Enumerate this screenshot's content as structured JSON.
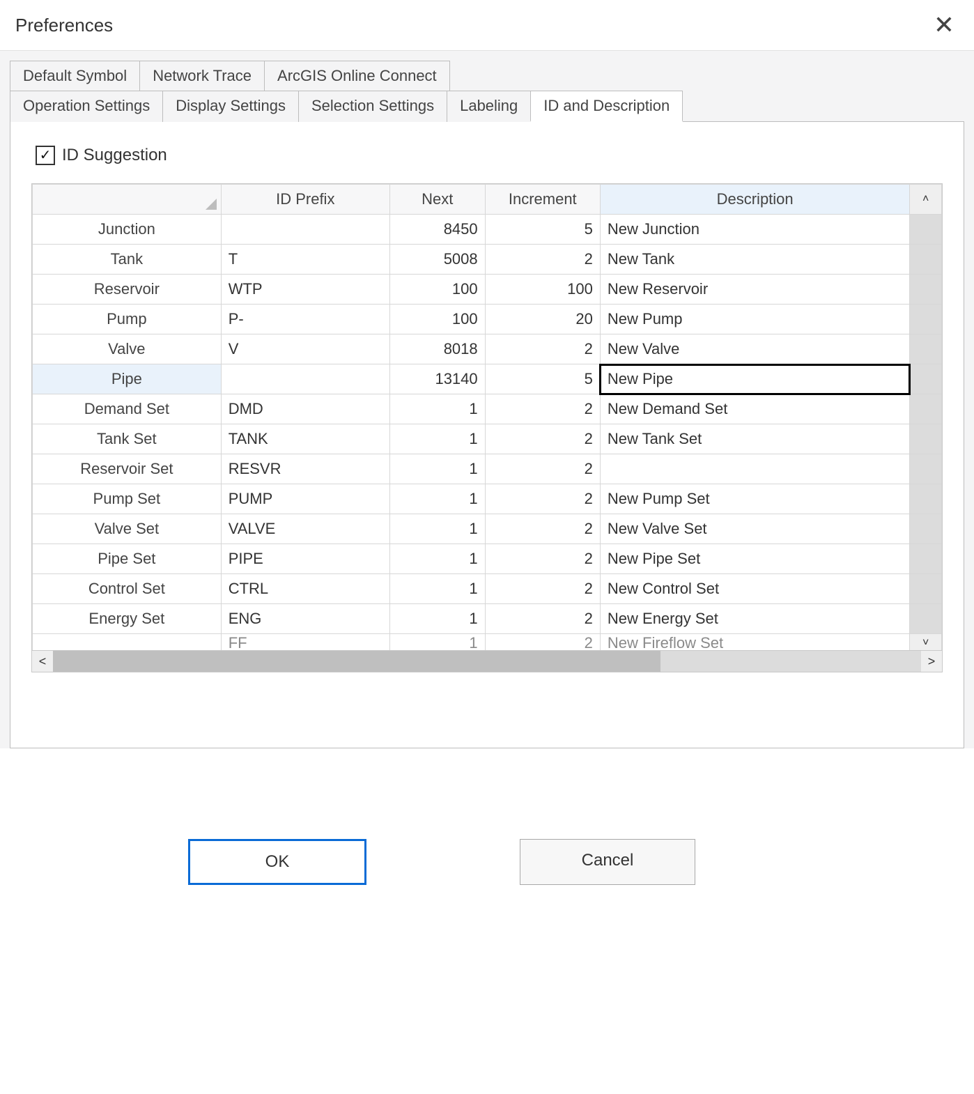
{
  "window": {
    "title": "Preferences"
  },
  "tabs_row1": [
    {
      "label": "Default Symbol"
    },
    {
      "label": "Network Trace"
    },
    {
      "label": "ArcGIS Online Connect"
    }
  ],
  "tabs_row2": [
    {
      "label": "Operation Settings"
    },
    {
      "label": "Display Settings"
    },
    {
      "label": "Selection Settings"
    },
    {
      "label": "Labeling"
    },
    {
      "label": "ID and Description",
      "active": true
    }
  ],
  "checkbox": {
    "label": "ID Suggestion",
    "checked": true
  },
  "grid": {
    "columns": {
      "rowhdr": "",
      "id_prefix": "ID Prefix",
      "next": "Next",
      "increment": "Increment",
      "description": "Description"
    },
    "rows": [
      {
        "name": "Junction",
        "prefix": "",
        "next": "8450",
        "inc": "5",
        "desc": "New Junction"
      },
      {
        "name": "Tank",
        "prefix": "T",
        "next": "5008",
        "inc": "2",
        "desc": "New Tank"
      },
      {
        "name": "Reservoir",
        "prefix": "WTP",
        "next": "100",
        "inc": "100",
        "desc": "New Reservoir"
      },
      {
        "name": "Pump",
        "prefix": "P-",
        "next": "100",
        "inc": "20",
        "desc": "New Pump"
      },
      {
        "name": "Valve",
        "prefix": "V",
        "next": "8018",
        "inc": "2",
        "desc": "New Valve"
      },
      {
        "name": "Pipe",
        "prefix": "",
        "next": "13140",
        "inc": "5",
        "desc": "New Pipe",
        "selected": true,
        "editing": "desc"
      },
      {
        "name": "Demand Set",
        "prefix": "DMD",
        "next": "1",
        "inc": "2",
        "desc": "New Demand Set"
      },
      {
        "name": "Tank Set",
        "prefix": "TANK",
        "next": "1",
        "inc": "2",
        "desc": "New Tank Set"
      },
      {
        "name": "Reservoir Set",
        "prefix": "RESVR",
        "next": "1",
        "inc": "2",
        "desc": ""
      },
      {
        "name": "Pump Set",
        "prefix": "PUMP",
        "next": "1",
        "inc": "2",
        "desc": "New Pump Set"
      },
      {
        "name": "Valve Set",
        "prefix": "VALVE",
        "next": "1",
        "inc": "2",
        "desc": "New Valve Set"
      },
      {
        "name": "Pipe Set",
        "prefix": "PIPE",
        "next": "1",
        "inc": "2",
        "desc": "New Pipe Set"
      },
      {
        "name": "Control Set",
        "prefix": "CTRL",
        "next": "1",
        "inc": "2",
        "desc": "New Control Set"
      },
      {
        "name": "Energy Set",
        "prefix": "ENG",
        "next": "1",
        "inc": "2",
        "desc": "New Energy Set"
      }
    ],
    "partial_row": {
      "name": "",
      "prefix": "FF",
      "next": "1",
      "inc": "2",
      "desc": "New Fireflow Set"
    },
    "scroll": {
      "up": "˄",
      "down": "˅",
      "left": "<",
      "right": ">"
    }
  },
  "buttons": {
    "ok": "OK",
    "cancel": "Cancel"
  }
}
